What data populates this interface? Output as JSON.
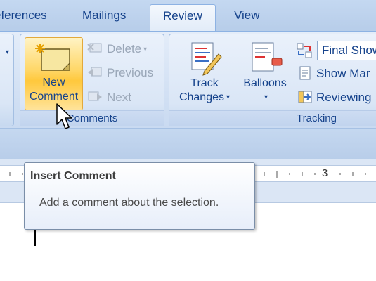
{
  "tabs": [
    {
      "label": "eferences",
      "active": false
    },
    {
      "label": "Mailings",
      "active": false
    },
    {
      "label": "Review",
      "active": true
    },
    {
      "label": "View",
      "active": false
    }
  ],
  "comments_group": {
    "label": "Comments",
    "new_comment_line1": "New",
    "new_comment_line2": "Comment",
    "delete_label": "Delete",
    "previous_label": "Previous",
    "next_label": "Next"
  },
  "tracking_group": {
    "label": "Tracking",
    "track_changes_line1": "Track",
    "track_changes_line2": "Changes",
    "balloons_label": "Balloons",
    "display_dropdown_value": "Final Show",
    "show_markup_label": "Show Mar",
    "reviewing_pane_label": "Reviewing"
  },
  "ruler": {
    "visible_number": "3"
  },
  "tooltip": {
    "title": "Insert Comment",
    "body": "Add a comment about the selection."
  },
  "colors": {
    "ribbon_text": "#15428b",
    "highlight": "#ffd767",
    "disabled_text": "#9aa7b8"
  }
}
